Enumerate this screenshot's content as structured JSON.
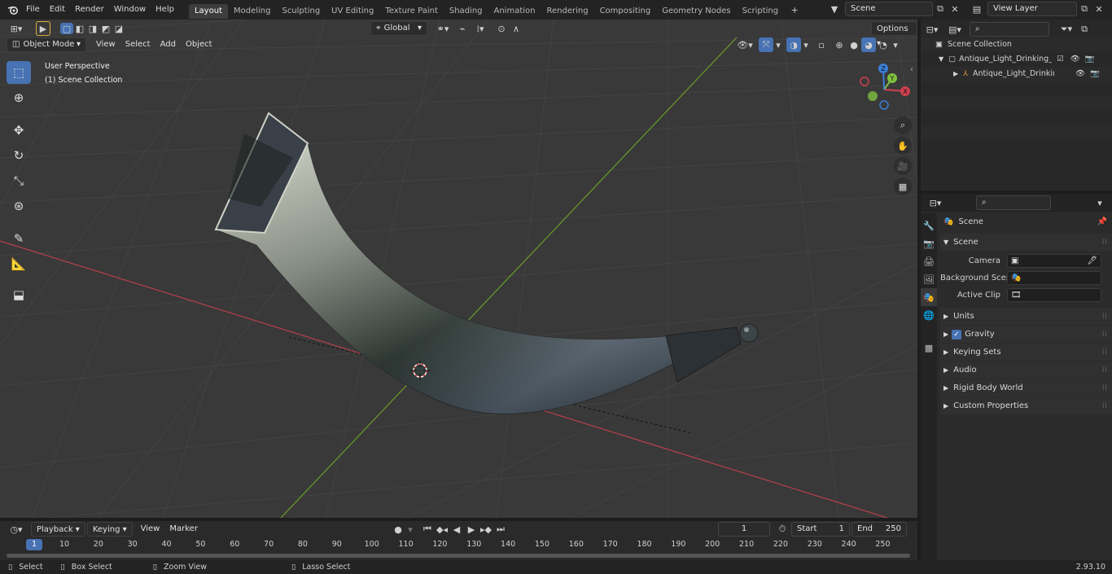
{
  "topbar": {
    "menus": [
      "File",
      "Edit",
      "Render",
      "Window",
      "Help"
    ],
    "workspaces": [
      "Layout",
      "Modeling",
      "Sculpting",
      "UV Editing",
      "Texture Paint",
      "Shading",
      "Animation",
      "Rendering",
      "Compositing",
      "Geometry Nodes",
      "Scripting"
    ],
    "active_workspace": "Layout",
    "scene_name": "Scene",
    "view_layer_name": "View Layer"
  },
  "viewport": {
    "mode": "Object Mode",
    "menus": [
      "View",
      "Select",
      "Add",
      "Object"
    ],
    "transform_orientation": "Global",
    "options_label": "Options",
    "overlay_line1": "User Perspective",
    "overlay_line2": "(1) Scene Collection",
    "gizmo_axes": [
      "X",
      "Y",
      "Z"
    ]
  },
  "outliner": {
    "root": "Scene Collection",
    "collection": "Antique_Light_Drinking_Horn_",
    "object": "Antique_Light_Drinking_H"
  },
  "properties": {
    "context": "Scene",
    "panel": "Scene",
    "fields": [
      {
        "label": "Camera"
      },
      {
        "label": "Background Scene"
      },
      {
        "label": "Active Clip"
      }
    ],
    "subpanels": [
      "Units",
      "Gravity",
      "Keying Sets",
      "Audio",
      "Rigid Body World",
      "Custom Properties"
    ],
    "gravity_checked": true
  },
  "timeline": {
    "menus": [
      "Playback",
      "Keying",
      "View",
      "Marker"
    ],
    "current_frame": "1",
    "start_label": "Start",
    "start_value": "1",
    "end_label": "End",
    "end_value": "250",
    "ticks": [
      "1",
      "10",
      "20",
      "30",
      "40",
      "50",
      "60",
      "70",
      "80",
      "90",
      "100",
      "110",
      "120",
      "130",
      "140",
      "150",
      "160",
      "170",
      "180",
      "190",
      "200",
      "210",
      "220",
      "230",
      "240",
      "250"
    ]
  },
  "statusbar": {
    "select": "Select",
    "box_select": "Box Select",
    "zoom_view": "Zoom View",
    "lasso_select": "Lasso Select",
    "version": "2.93.10"
  },
  "colors": {
    "accent": "#4772b3",
    "x_axis": "#b6404a",
    "y_axis": "#6a9b2a"
  }
}
